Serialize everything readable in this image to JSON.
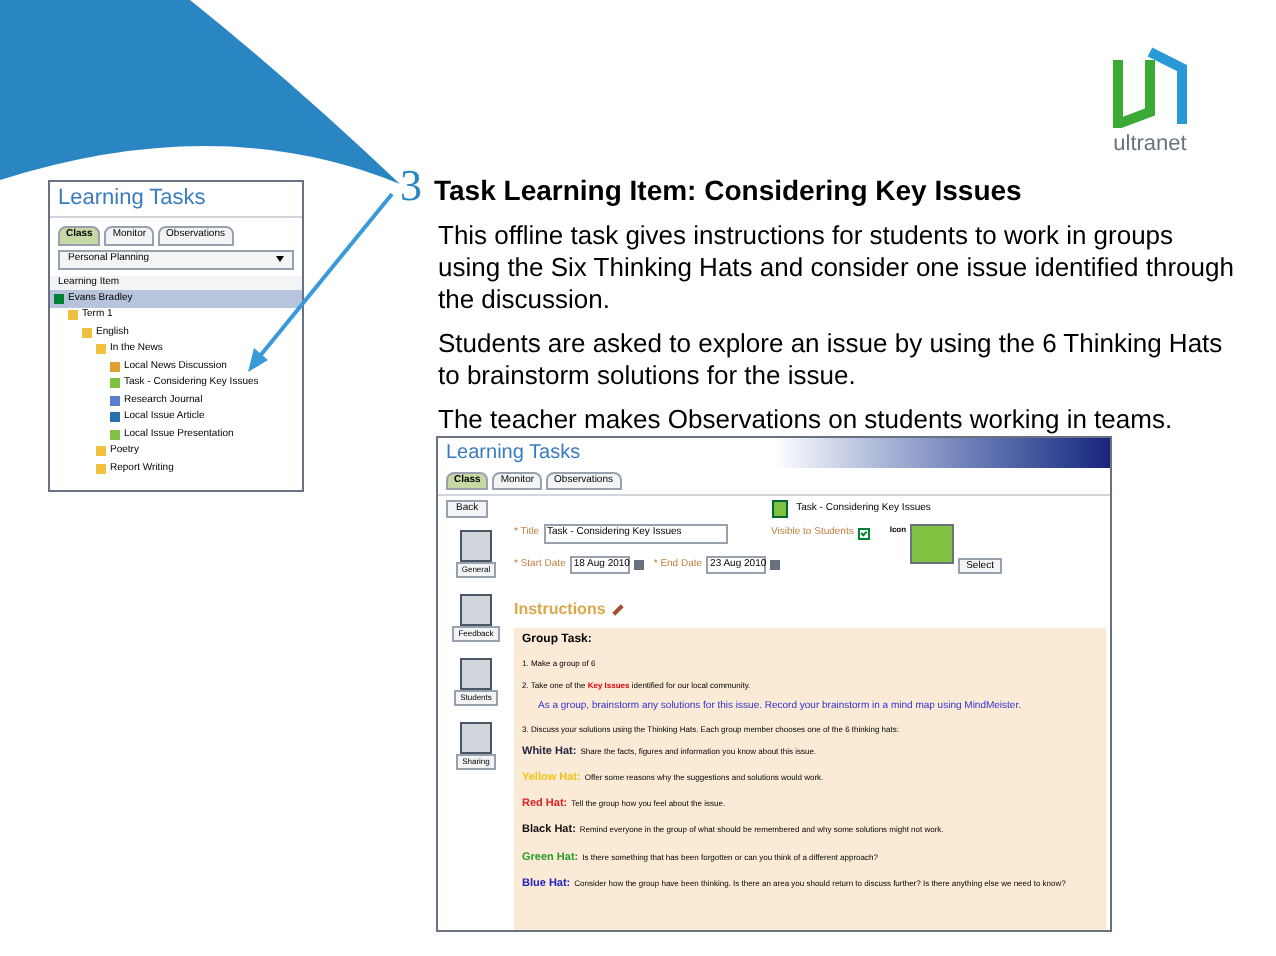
{
  "logo": {
    "text": "ultranet"
  },
  "left_panel": {
    "title": "Learning Tasks",
    "tabs": [
      {
        "label": "Class",
        "selected": true
      },
      {
        "label": "Monitor",
        "selected": false
      },
      {
        "label": "Observations",
        "selected": false
      }
    ],
    "dropdown": "Personal Planning",
    "tree_header": "Learning Item",
    "tree": [
      {
        "label": "Evans Bradley",
        "kind": "person",
        "selected": true,
        "children": [
          {
            "label": "Term 1",
            "kind": "folder",
            "selected": false,
            "children": [
              {
                "label": "English",
                "kind": "folder",
                "selected": false,
                "children": [
                  {
                    "label": "In the News",
                    "kind": "folder",
                    "selected": false,
                    "children": [
                      {
                        "label": "Local News Discussion",
                        "kind": "discussion",
                        "selected": false
                      },
                      {
                        "label": "Task - Considering Key Issues",
                        "kind": "task",
                        "selected": false
                      },
                      {
                        "label": "Research Journal",
                        "kind": "journal",
                        "selected": false
                      },
                      {
                        "label": "Local Issue Article",
                        "kind": "article",
                        "selected": false
                      },
                      {
                        "label": "Local Issue Presentation",
                        "kind": "task",
                        "selected": false
                      }
                    ]
                  },
                  {
                    "label": "Poetry",
                    "kind": "folder",
                    "selected": false
                  },
                  {
                    "label": "Report Writing",
                    "kind": "folder",
                    "selected": false
                  }
                ]
              }
            ]
          }
        ]
      }
    ]
  },
  "step": {
    "number": "3",
    "title": "Task Learning Item: Considering Key Issues"
  },
  "paragraphs": [
    "This offline task gives instructions for students to work in groups using the Six Thinking Hats and consider one issue identified through the discussion.",
    "Students are asked to explore an issue by using the 6 Thinking Hats to brainstorm solutions for the issue.",
    "The teacher makes Observations on students working in teams."
  ],
  "screenshot": {
    "title": "Learning Tasks",
    "tabs": [
      {
        "label": "Class",
        "selected": true
      },
      {
        "label": "Monitor",
        "selected": false
      },
      {
        "label": "Observations",
        "selected": false
      }
    ],
    "back_button": "Back",
    "header": "Task - Considering Key Issues",
    "side_items": [
      "General",
      "Feedback",
      "Students",
      "Sharing"
    ],
    "form": {
      "title_label": "* Title",
      "title_value": "Task - Considering Key Issues",
      "visible_label": "Visible to Students",
      "visible_checked": true,
      "start_label": "* Start Date",
      "start_value": "18 Aug 2010",
      "end_label": "* End Date",
      "end_value": "23 Aug 2010",
      "icon_label": "Icon",
      "select_button": "Select"
    },
    "instructions_heading": "Instructions",
    "group_task": "Group Task:",
    "steps": [
      "1. Make a group of 6",
      "2. Take one of the **Key Issues** identified for our local community."
    ],
    "highlight": "As a group, brainstorm any solutions for this issue. Record your brainstorm in a mind map using MindMeister.",
    "step_3": "3. Discuss your solutions using the Thinking Hats. Each group member chooses one of the 6 thinking hats:",
    "hats": [
      {
        "name": "White Hat:",
        "color": "#222244",
        "text": "Share the facts, figures and information you know about this issue."
      },
      {
        "name": "Yellow Hat:",
        "color": "#f0c419",
        "text": "Offer some reasons why the suggestions and solutions would work."
      },
      {
        "name": "Red Hat:",
        "color": "#e02020",
        "text": "Tell the group how you feel about the issue."
      },
      {
        "name": "Black Hat:",
        "color": "#111111",
        "text": "Remind everyone in the group of what should be remembered and why some solutions might not work."
      },
      {
        "name": "Green Hat:",
        "color": "#2a9a2a",
        "text": "Is there something that has been forgotten or can you think of a different approach?"
      },
      {
        "name": "Blue Hat:",
        "color": "#2020c0",
        "text": "Consider how the group have been thinking. Is there an area you should return to discuss further? Is there anything else we need to know?"
      }
    ]
  }
}
